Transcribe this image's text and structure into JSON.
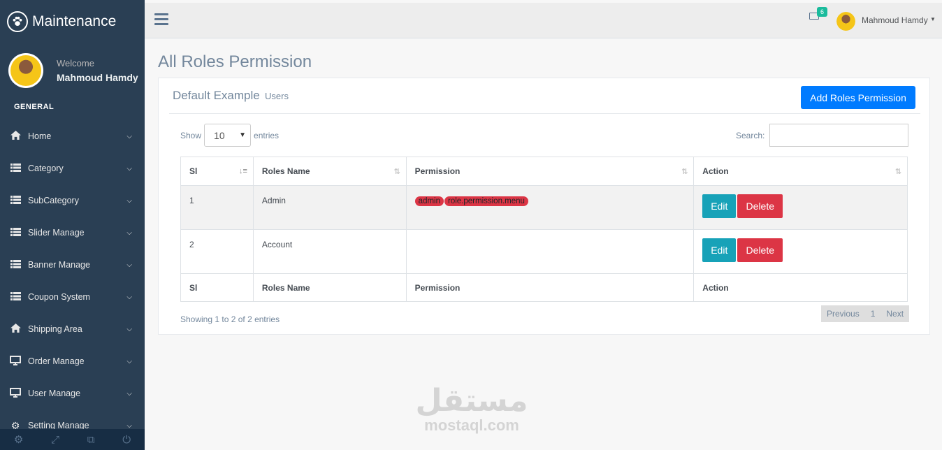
{
  "brand": {
    "title": "Maintenance"
  },
  "profile": {
    "welcome": "Welcome",
    "name": "Mahmoud Hamdy"
  },
  "sidebar": {
    "section": "GENERAL",
    "items": [
      {
        "label": "Home",
        "icon": "home-icon"
      },
      {
        "label": "Category",
        "icon": "list-icon"
      },
      {
        "label": "SubCategory",
        "icon": "list-icon"
      },
      {
        "label": "Slider Manage",
        "icon": "list-icon"
      },
      {
        "label": "Banner Manage",
        "icon": "list-icon"
      },
      {
        "label": "Coupon System",
        "icon": "list-icon"
      },
      {
        "label": "Shipping Area",
        "icon": "home-icon"
      },
      {
        "label": "Order Manage",
        "icon": "desktop-icon"
      },
      {
        "label": "User Manage",
        "icon": "desktop-icon"
      },
      {
        "label": "Setting Manage",
        "icon": "gear-icon"
      }
    ]
  },
  "topnav": {
    "mail_count": "6",
    "user": "Mahmoud Hamdy"
  },
  "page": {
    "title": "All Roles Permission"
  },
  "panel": {
    "title": "Default Example",
    "subtitle": "Users",
    "add_button": "Add Roles Permission"
  },
  "datatable": {
    "show_label": "Show",
    "entries_label": "entries",
    "page_length": "10",
    "search_label": "Search:",
    "search_value": "",
    "columns": [
      "Sl",
      "Roles Name",
      "Permission",
      "Action"
    ],
    "rows": [
      {
        "sl": "1",
        "role": "Admin",
        "permissions": [
          "admin",
          "role.permission.menu"
        ]
      },
      {
        "sl": "2",
        "role": "Account",
        "permissions": []
      }
    ],
    "edit_label": "Edit",
    "delete_label": "Delete",
    "info": "Showing 1 to 2 of 2 entries",
    "pagination": {
      "previous": "Previous",
      "page": "1",
      "next": "Next"
    }
  },
  "watermark": {
    "arabic": "مستقل",
    "latin": "mostaql.com"
  },
  "colors": {
    "sidebar": "#2a3f54",
    "primary": "#007bff",
    "info": "#17a2b8",
    "danger": "#dc3545",
    "badge_green": "#1abb9c"
  }
}
